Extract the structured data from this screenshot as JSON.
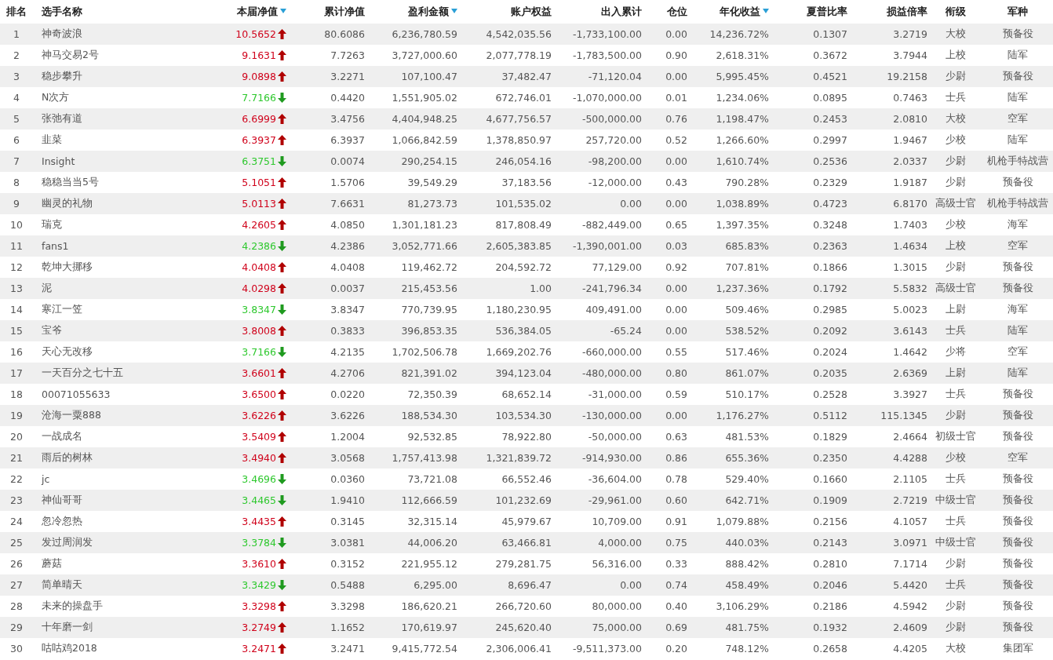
{
  "columns": [
    {
      "label": "排名",
      "kind": "rank",
      "sort_icon": false
    },
    {
      "label": "选手名称",
      "kind": "text",
      "sort_icon": false
    },
    {
      "label": "本届净值",
      "kind": "trend",
      "sort_icon": true
    },
    {
      "label": "累计净值",
      "kind": "number",
      "sort_icon": false
    },
    {
      "label": "盈利金额",
      "kind": "number",
      "sort_icon": true
    },
    {
      "label": "账户权益",
      "kind": "number",
      "sort_icon": false
    },
    {
      "label": "出入累计",
      "kind": "number",
      "sort_icon": false
    },
    {
      "label": "仓位",
      "kind": "number",
      "sort_icon": false
    },
    {
      "label": "年化收益",
      "kind": "number",
      "sort_icon": true
    },
    {
      "label": "夏普比率",
      "kind": "number",
      "sort_icon": false
    },
    {
      "label": "损益倍率",
      "kind": "number",
      "sort_icon": false
    },
    {
      "label": "衔级",
      "kind": "tag",
      "sort_icon": false
    },
    {
      "label": "军种",
      "kind": "tag",
      "sort_icon": false
    }
  ],
  "rows": [
    {
      "kind": "up",
      "cells": [
        "1",
        "神奇波浪",
        "10.5652",
        "80.6086",
        "6,236,780.59",
        "4,542,035.56",
        "-1,733,100.00",
        "0.00",
        "14,236.72%",
        "0.1307",
        "3.2719",
        "大校",
        "预备役"
      ]
    },
    {
      "kind": "up",
      "cells": [
        "2",
        "神马交易2号",
        "9.1631",
        "7.7263",
        "3,727,000.60",
        "2,077,778.19",
        "-1,783,500.00",
        "0.90",
        "2,618.31%",
        "0.3672",
        "3.7944",
        "上校",
        "陆军"
      ]
    },
    {
      "kind": "up",
      "cells": [
        "3",
        "稳步攀升",
        "9.0898",
        "3.2271",
        "107,100.47",
        "37,482.47",
        "-71,120.04",
        "0.00",
        "5,995.45%",
        "0.4521",
        "19.2158",
        "少尉",
        "预备役"
      ]
    },
    {
      "kind": "down",
      "cells": [
        "4",
        "N次方",
        "7.7166",
        "0.4420",
        "1,551,905.02",
        "672,746.01",
        "-1,070,000.00",
        "0.01",
        "1,234.06%",
        "0.0895",
        "0.7463",
        "士兵",
        "陆军"
      ]
    },
    {
      "kind": "up",
      "cells": [
        "5",
        "张弛有道",
        "6.6999",
        "3.4756",
        "4,404,948.25",
        "4,677,756.57",
        "-500,000.00",
        "0.76",
        "1,198.47%",
        "0.2453",
        "2.0810",
        "大校",
        "空军"
      ]
    },
    {
      "kind": "up",
      "cells": [
        "6",
        "韭菜",
        "6.3937",
        "6.3937",
        "1,066,842.59",
        "1,378,850.97",
        "257,720.00",
        "0.52",
        "1,266.60%",
        "0.2997",
        "1.9467",
        "少校",
        "陆军"
      ]
    },
    {
      "kind": "down",
      "cells": [
        "7",
        "Insight",
        "6.3751",
        "0.0074",
        "290,254.15",
        "246,054.16",
        "-98,200.00",
        "0.00",
        "1,610.74%",
        "0.2536",
        "2.0337",
        "少尉",
        "机枪手特战营"
      ]
    },
    {
      "kind": "up",
      "cells": [
        "8",
        "稳稳当当5号",
        "5.1051",
        "1.5706",
        "39,549.29",
        "37,183.56",
        "-12,000.00",
        "0.43",
        "790.28%",
        "0.2329",
        "1.9187",
        "少尉",
        "预备役"
      ]
    },
    {
      "kind": "up",
      "cells": [
        "9",
        "幽灵的礼物",
        "5.0113",
        "7.6631",
        "81,273.73",
        "101,535.02",
        "0.00",
        "0.00",
        "1,038.89%",
        "0.4723",
        "6.8170",
        "高级士官",
        "机枪手特战营"
      ]
    },
    {
      "kind": "up",
      "cells": [
        "10",
        "瑞克",
        "4.2605",
        "4.0850",
        "1,301,181.23",
        "817,808.49",
        "-882,449.00",
        "0.65",
        "1,397.35%",
        "0.3248",
        "1.7403",
        "少校",
        "海军"
      ]
    },
    {
      "kind": "down",
      "cells": [
        "11",
        "fans1",
        "4.2386",
        "4.2386",
        "3,052,771.66",
        "2,605,383.85",
        "-1,390,001.00",
        "0.03",
        "685.83%",
        "0.2363",
        "1.4634",
        "上校",
        "空军"
      ]
    },
    {
      "kind": "up",
      "cells": [
        "12",
        "乾坤大挪移",
        "4.0408",
        "4.0408",
        "119,462.72",
        "204,592.72",
        "77,129.00",
        "0.92",
        "707.81%",
        "0.1866",
        "1.3015",
        "少尉",
        "预备役"
      ]
    },
    {
      "kind": "up",
      "cells": [
        "13",
        "泥",
        "4.0298",
        "0.0037",
        "215,453.56",
        "1.00",
        "-241,796.34",
        "0.00",
        "1,237.36%",
        "0.1792",
        "5.5832",
        "高级士官",
        "预备役"
      ]
    },
    {
      "kind": "down",
      "cells": [
        "14",
        "寒江一笠",
        "3.8347",
        "3.8347",
        "770,739.95",
        "1,180,230.95",
        "409,491.00",
        "0.00",
        "509.46%",
        "0.2985",
        "5.0023",
        "上尉",
        "海军"
      ]
    },
    {
      "kind": "up",
      "cells": [
        "15",
        "宝爷",
        "3.8008",
        "0.3833",
        "396,853.35",
        "536,384.05",
        "-65.24",
        "0.00",
        "538.52%",
        "0.2092",
        "3.6143",
        "士兵",
        "陆军"
      ]
    },
    {
      "kind": "down",
      "cells": [
        "16",
        "天心无改移",
        "3.7166",
        "4.2135",
        "1,702,506.78",
        "1,669,202.76",
        "-660,000.00",
        "0.55",
        "517.46%",
        "0.2024",
        "1.4642",
        "少将",
        "空军"
      ]
    },
    {
      "kind": "up",
      "cells": [
        "17",
        "一天百分之七十五",
        "3.6601",
        "4.2706",
        "821,391.02",
        "394,123.04",
        "-480,000.00",
        "0.80",
        "861.07%",
        "0.2035",
        "2.6369",
        "上尉",
        "陆军"
      ]
    },
    {
      "kind": "up",
      "cells": [
        "18",
        "00071055633",
        "3.6500",
        "0.0220",
        "72,350.39",
        "68,652.14",
        "-31,000.00",
        "0.59",
        "510.17%",
        "0.2528",
        "3.3927",
        "士兵",
        "预备役"
      ]
    },
    {
      "kind": "up",
      "cells": [
        "19",
        "沧海一粟888",
        "3.6226",
        "3.6226",
        "188,534.30",
        "103,534.30",
        "-130,000.00",
        "0.00",
        "1,176.27%",
        "0.5112",
        "115.1345",
        "少尉",
        "预备役"
      ]
    },
    {
      "kind": "up",
      "cells": [
        "20",
        "一战成名",
        "3.5409",
        "1.2004",
        "92,532.85",
        "78,922.80",
        "-50,000.00",
        "0.63",
        "481.53%",
        "0.1829",
        "2.4664",
        "初级士官",
        "预备役"
      ]
    },
    {
      "kind": "up",
      "cells": [
        "21",
        "雨后的树林",
        "3.4940",
        "3.0568",
        "1,757,413.98",
        "1,321,839.72",
        "-914,930.00",
        "0.86",
        "655.36%",
        "0.2350",
        "4.4288",
        "少校",
        "空军"
      ]
    },
    {
      "kind": "down",
      "cells": [
        "22",
        "jc",
        "3.4696",
        "0.0360",
        "73,721.08",
        "66,552.46",
        "-36,604.00",
        "0.78",
        "529.40%",
        "0.1660",
        "2.1105",
        "士兵",
        "预备役"
      ]
    },
    {
      "kind": "down",
      "cells": [
        "23",
        "神仙哥哥",
        "3.4465",
        "1.9410",
        "112,666.59",
        "101,232.69",
        "-29,961.00",
        "0.60",
        "642.71%",
        "0.1909",
        "2.7219",
        "中级士官",
        "预备役"
      ]
    },
    {
      "kind": "up",
      "cells": [
        "24",
        "忽冷忽热",
        "3.4435",
        "0.3145",
        "32,315.14",
        "45,979.67",
        "10,709.00",
        "0.91",
        "1,079.88%",
        "0.2156",
        "4.1057",
        "士兵",
        "预备役"
      ]
    },
    {
      "kind": "down",
      "cells": [
        "25",
        "发过周润发",
        "3.3784",
        "3.0381",
        "44,006.20",
        "63,466.81",
        "4,000.00",
        "0.75",
        "440.03%",
        "0.2143",
        "3.0971",
        "中级士官",
        "预备役"
      ]
    },
    {
      "kind": "up",
      "cells": [
        "26",
        "蘑菇",
        "3.3610",
        "0.3152",
        "221,955.12",
        "279,281.75",
        "56,316.00",
        "0.33",
        "888.42%",
        "0.2810",
        "7.1714",
        "少尉",
        "预备役"
      ]
    },
    {
      "kind": "down",
      "cells": [
        "27",
        "简单晴天",
        "3.3429",
        "0.5488",
        "6,295.00",
        "8,696.47",
        "0.00",
        "0.74",
        "458.49%",
        "0.2046",
        "5.4420",
        "士兵",
        "预备役"
      ]
    },
    {
      "kind": "up",
      "cells": [
        "28",
        "未来的操盘手",
        "3.3298",
        "3.3298",
        "186,620.21",
        "266,720.60",
        "80,000.00",
        "0.40",
        "3,106.29%",
        "0.2186",
        "4.5942",
        "少尉",
        "预备役"
      ]
    },
    {
      "kind": "up",
      "cells": [
        "29",
        "十年磨一剑",
        "3.2749",
        "1.1652",
        "170,619.97",
        "245,620.40",
        "75,000.00",
        "0.69",
        "481.75%",
        "0.1932",
        "2.4609",
        "少尉",
        "预备役"
      ]
    },
    {
      "kind": "up",
      "cells": [
        "30",
        "咕咕鸡2018",
        "3.2471",
        "3.2471",
        "9,415,772.54",
        "2,306,006.41",
        "-9,511,373.00",
        "0.20",
        "748.12%",
        "0.2658",
        "4.4205",
        "大校",
        "集团军"
      ]
    }
  ]
}
